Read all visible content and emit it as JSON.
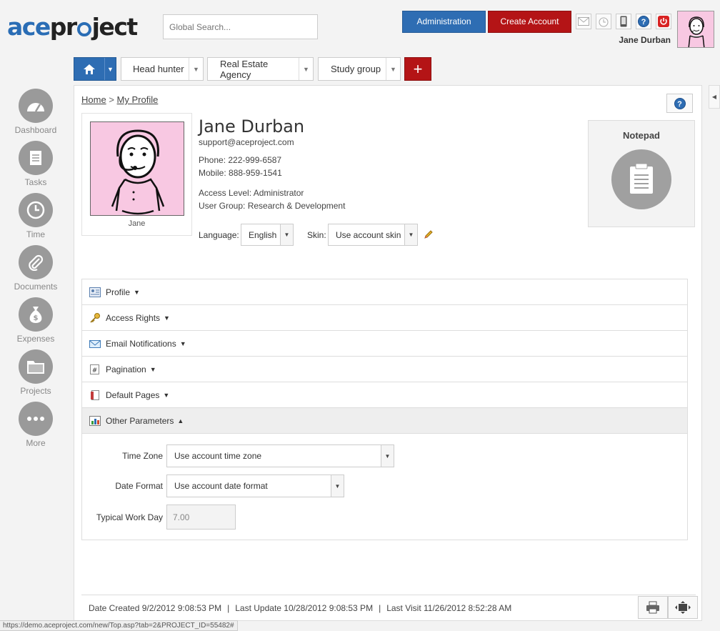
{
  "header": {
    "logo_ace": "ace",
    "logo_project": "proj ct",
    "search_placeholder": "Global Search...",
    "admin_label": "Administration",
    "create_account_label": "Create Account",
    "user_name": "Jane Durban",
    "icons": [
      "mail-icon",
      "alarm-icon",
      "phone-icon",
      "help-icon",
      "power-icon"
    ]
  },
  "tabs": {
    "items": [
      {
        "label": "Head hunter"
      },
      {
        "label": "Real Estate Agency"
      },
      {
        "label": "Study group"
      }
    ],
    "add_label": "+"
  },
  "sidebar": {
    "items": [
      {
        "label": "Dashboard",
        "icon": "dashboard-icon"
      },
      {
        "label": "Tasks",
        "icon": "tasks-icon"
      },
      {
        "label": "Time",
        "icon": "clock-icon"
      },
      {
        "label": "Documents",
        "icon": "paperclip-icon"
      },
      {
        "label": "Expenses",
        "icon": "money-bag-icon"
      },
      {
        "label": "Projects",
        "icon": "folder-icon"
      },
      {
        "label": "More",
        "icon": "more-icon"
      }
    ]
  },
  "breadcrumb": {
    "home": "Home",
    "separator": ">",
    "current": "My Profile"
  },
  "profile": {
    "photo_caption": "Jane",
    "name": "Jane Durban",
    "email": "support@aceproject.com",
    "phone": "Phone: 222-999-6587",
    "mobile": "Mobile: 888-959-1541",
    "access_level": "Access Level: Administrator",
    "user_group": "User Group: Research & Development",
    "language_label": "Language:",
    "language_value": "English",
    "skin_label": "Skin:",
    "skin_value": "Use account skin"
  },
  "notepad": {
    "title": "Notepad"
  },
  "sections": [
    {
      "label": "Profile",
      "caret": "▼"
    },
    {
      "label": "Access Rights",
      "caret": "▼"
    },
    {
      "label": "Email Notifications",
      "caret": "▼"
    },
    {
      "label": "Pagination",
      "caret": "▼"
    },
    {
      "label": "Default Pages",
      "caret": "▼"
    },
    {
      "label": "Other Parameters",
      "caret": "▲"
    }
  ],
  "other_parameters": {
    "time_zone_label": "Time Zone",
    "time_zone_value": "Use account time zone",
    "date_format_label": "Date Format",
    "date_format_value": "Use account date format",
    "work_day_label": "Typical Work Day",
    "work_day_value": "7.00"
  },
  "footer": {
    "date_created": "Date Created 9/2/2012 9:08:53 PM",
    "last_update": "Last Update 10/28/2012 9:08:53 PM",
    "last_visit": "Last Visit 11/26/2012 8:52:28 AM",
    "separator": "|"
  },
  "statusbar": {
    "url": "https://demo.aceproject.com/new/Top.asp?tab=2&PROJECT_ID=55482#"
  },
  "colors": {
    "accent_blue": "#2e6db3",
    "accent_red": "#b41416",
    "avatar_pink": "#f8c8e2"
  }
}
